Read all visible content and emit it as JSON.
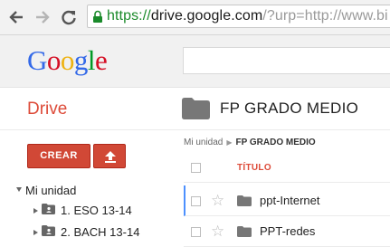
{
  "browser": {
    "url_scheme": "https://",
    "url_host": "drive.google.com",
    "url_rest": "/?urp=http://www.bi",
    "icons": [
      "back-arrow-icon",
      "forward-arrow-icon",
      "reload-icon",
      "lock-icon"
    ]
  },
  "header": {
    "logo_letters": [
      "G",
      "o",
      "o",
      "g",
      "l",
      "e"
    ],
    "logo_colors": [
      "#3369e8",
      "#d50f25",
      "#eeb211",
      "#3369e8",
      "#009925",
      "#d50f25"
    ]
  },
  "drive": {
    "label": "Drive",
    "folder_title": "FP GRADO MEDIO"
  },
  "sidebar": {
    "create_label": "CREAR",
    "tree_root": "Mi unidad",
    "items": [
      {
        "label": "1. ESO 13-14"
      },
      {
        "label": "2. BACH 13-14"
      }
    ]
  },
  "content": {
    "breadcrumb_root": "Mi unidad",
    "breadcrumb_current": "FP GRADO MEDIO",
    "column_title": "TÍTULO",
    "rows": [
      {
        "name": "ppt-Internet"
      },
      {
        "name": "PPT-redes"
      }
    ]
  },
  "colors": {
    "accent_red": "#dd4b39",
    "button_red": "#d14836",
    "url_green": "#1a8a2a",
    "selection_blue": "#4d90fe"
  }
}
